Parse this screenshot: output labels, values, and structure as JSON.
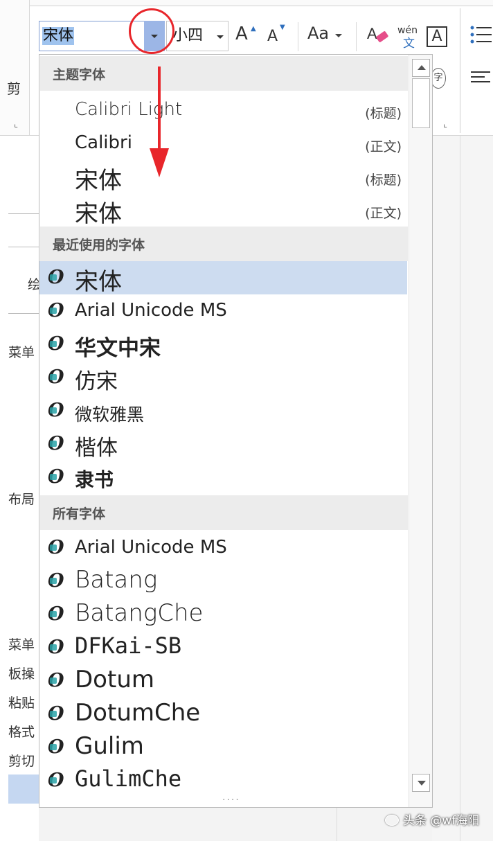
{
  "ribbon": {
    "font_box_value": "宋体",
    "size_box_value": "小四",
    "grow_font_glyph": "A",
    "shrink_font_glyph": "A",
    "case_glyph": "Aa",
    "phonetic_top": "wén",
    "phonetic_bottom": "文",
    "border_glyph": "A",
    "encircle_glyph": "字",
    "left_fragment": "剪"
  },
  "dropdown": {
    "sections": {
      "theme": "主题字体",
      "recent": "最近使用的字体",
      "all": "所有字体"
    },
    "theme_fonts": [
      {
        "name": "Calibri Light",
        "tag": "(标题)"
      },
      {
        "name": "Calibri",
        "tag": "(正文)"
      },
      {
        "name": "宋体",
        "tag": "(标题)"
      },
      {
        "name": "宋体",
        "tag": "(正文)"
      }
    ],
    "recent_fonts": [
      {
        "name": "宋体",
        "selected": true
      },
      {
        "name": "Arial Unicode MS"
      },
      {
        "name": "华文中宋"
      },
      {
        "name": "仿宋"
      },
      {
        "name": "微软雅黑"
      },
      {
        "name": "楷体"
      },
      {
        "name": "隶书"
      }
    ],
    "all_fonts": [
      {
        "name": "Arial Unicode MS"
      },
      {
        "name": "Batang"
      },
      {
        "name": "BatangChe"
      },
      {
        "name": "DFKai-SB"
      },
      {
        "name": "Dotum"
      },
      {
        "name": "DotumChe"
      },
      {
        "name": "Gulim"
      },
      {
        "name": "GulimChe"
      }
    ],
    "grip": "....",
    "truetype_icon": "truetype-font-icon"
  },
  "background_fragments": {
    "f1": "绘",
    "f2": "菜单",
    "f3": "布局",
    "f4": "菜单",
    "f5": "板操",
    "f6": "粘贴",
    "f7": "格式",
    "f8": "剪切"
  },
  "watermark": "头条 @wf海阳",
  "colors": {
    "annotation_red": "#e8262b",
    "selection_blue": "#cddcf0",
    "dropdown_button": "#9cb6e6",
    "truetype_teal": "#2aa3a8"
  }
}
